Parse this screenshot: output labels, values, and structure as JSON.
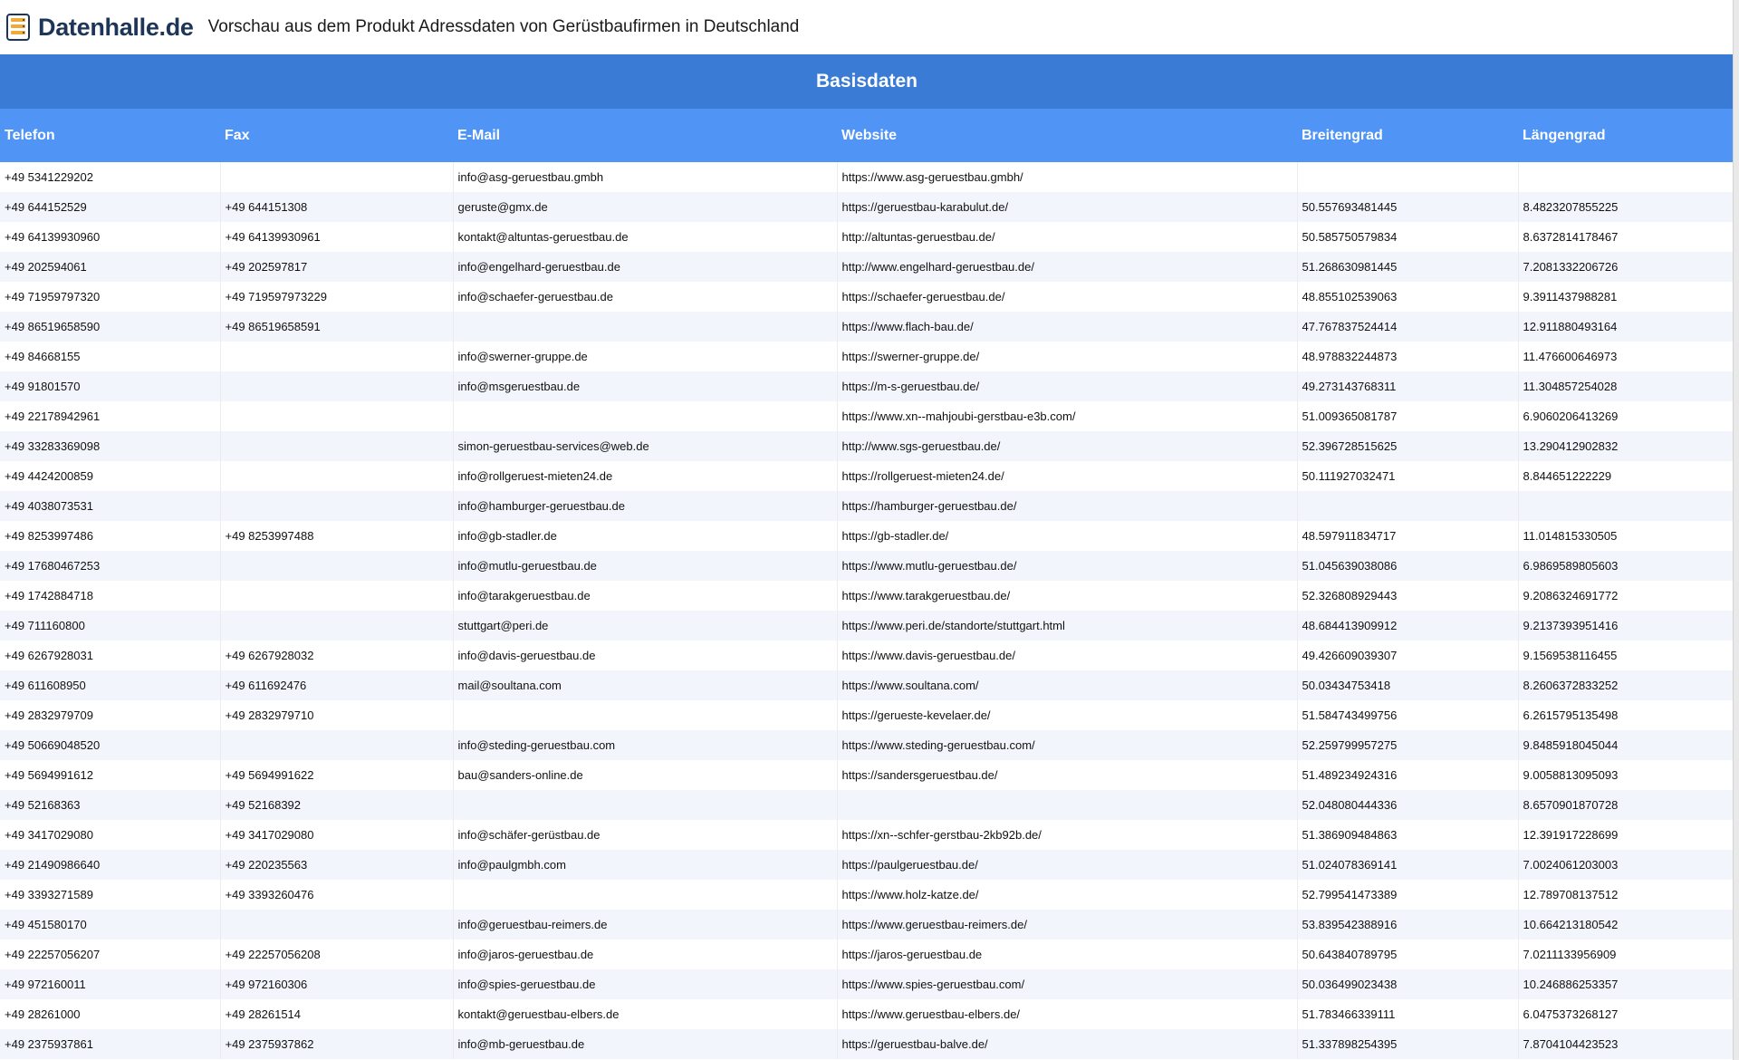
{
  "app": {
    "logo_text": "Datenhalle.de",
    "title": "Vorschau aus dem Produkt Adressdaten von Gerüstbaufirmen in Deutschland"
  },
  "section": {
    "title": "Basisdaten"
  },
  "table": {
    "columns": [
      "Telefon",
      "Fax",
      "E-Mail",
      "Website",
      "Breitengrad",
      "Längengrad"
    ],
    "rows": [
      [
        "+49 5341229202",
        "",
        "info@asg-geruestbau.gmbh",
        "https://www.asg-geruestbau.gmbh/",
        "",
        ""
      ],
      [
        "+49 644152529",
        "+49 644151308",
        "geruste@gmx.de",
        "https://geruestbau-karabulut.de/",
        "50.557693481445",
        "8.4823207855225"
      ],
      [
        "+49 64139930960",
        "+49 64139930961",
        "kontakt@altuntas-geruestbau.de",
        "http://altuntas-geruestbau.de/",
        "50.585750579834",
        "8.6372814178467"
      ],
      [
        "+49 202594061",
        "+49 202597817",
        "info@engelhard-geruestbau.de",
        "http://www.engelhard-geruestbau.de/",
        "51.268630981445",
        "7.2081332206726"
      ],
      [
        "+49 71959797320",
        "+49 719597973229",
        "info@schaefer-geruestbau.de",
        "https://schaefer-geruestbau.de/",
        "48.855102539063",
        "9.3911437988281"
      ],
      [
        "+49 86519658590",
        "+49 86519658591",
        "",
        "https://www.flach-bau.de/",
        "47.767837524414",
        "12.911880493164"
      ],
      [
        "+49 84668155",
        "",
        "info@swerner-gruppe.de",
        "https://swerner-gruppe.de/",
        "48.978832244873",
        "11.476600646973"
      ],
      [
        "+49 91801570",
        "",
        "info@msgeruestbau.de",
        "https://m-s-geruestbau.de/",
        "49.273143768311",
        "11.304857254028"
      ],
      [
        "+49 22178942961",
        "",
        "",
        "https://www.xn--mahjoubi-gerstbau-e3b.com/",
        "51.009365081787",
        "6.9060206413269"
      ],
      [
        "+49 33283369098",
        "",
        "simon-geruestbau-services@web.de",
        "http://www.sgs-geruestbau.de/",
        "52.396728515625",
        "13.290412902832"
      ],
      [
        "+49 4424200859",
        "",
        "info@rollgeruest-mieten24.de",
        "https://rollgeruest-mieten24.de/",
        "50.111927032471",
        "8.844651222229"
      ],
      [
        "+49 4038073531",
        "",
        "info@hamburger-geruestbau.de",
        "https://hamburger-geruestbau.de/",
        "",
        ""
      ],
      [
        "+49 8253997486",
        "+49 8253997488",
        "info@gb-stadler.de",
        "https://gb-stadler.de/",
        "48.597911834717",
        "11.014815330505"
      ],
      [
        "+49 17680467253",
        "",
        "info@mutlu-geruestbau.de",
        "https://www.mutlu-geruestbau.de/",
        "51.045639038086",
        "6.9869589805603"
      ],
      [
        "+49 1742884718",
        "",
        "info@tarakgeruestbau.de",
        "https://www.tarakgeruestbau.de/",
        "52.326808929443",
        "9.2086324691772"
      ],
      [
        "+49 711160800",
        "",
        "stuttgart@peri.de",
        "https://www.peri.de/standorte/stuttgart.html",
        "48.684413909912",
        "9.2137393951416"
      ],
      [
        "+49 6267928031",
        "+49 6267928032",
        "info@davis-geruestbau.de",
        "https://www.davis-geruestbau.de/",
        "49.426609039307",
        "9.1569538116455"
      ],
      [
        "+49 611608950",
        "+49 611692476",
        "mail@soultana.com",
        "https://www.soultana.com/",
        "50.03434753418",
        "8.2606372833252"
      ],
      [
        "+49 2832979709",
        "+49 2832979710",
        "",
        "https://gerueste-kevelaer.de/",
        "51.584743499756",
        "6.2615795135498"
      ],
      [
        "+49 50669048520",
        "",
        "info@steding-geruestbau.com",
        "https://www.steding-geruestbau.com/",
        "52.259799957275",
        "9.8485918045044"
      ],
      [
        "+49 5694991612",
        "+49 5694991622",
        "bau@sanders-online.de",
        "https://sandersgeruestbau.de/",
        "51.489234924316",
        "9.0058813095093"
      ],
      [
        "+49 52168363",
        "+49 52168392",
        "",
        "",
        "52.048080444336",
        "8.6570901870728"
      ],
      [
        "+49 3417029080",
        "+49 3417029080",
        "info@schäfer-gerüstbau.de",
        "https://xn--schfer-gerstbau-2kb92b.de/",
        "51.386909484863",
        "12.391917228699"
      ],
      [
        "+49 21490986640",
        "+49 220235563",
        "info@paulgmbh.com",
        "https://paulgeruestbau.de/",
        "51.024078369141",
        "7.0024061203003"
      ],
      [
        "+49 3393271589",
        "+49 3393260476",
        "",
        "https://www.holz-katze.de/",
        "52.799541473389",
        "12.789708137512"
      ],
      [
        "+49 451580170",
        "",
        "info@geruestbau-reimers.de",
        "https://www.geruestbau-reimers.de/",
        "53.839542388916",
        "10.664213180542"
      ],
      [
        "+49 22257056207",
        "+49 22257056208",
        "info@jaros-geruestbau.de",
        "https://jaros-geruestbau.de",
        "50.643840789795",
        "7.0211133956909"
      ],
      [
        "+49 972160011",
        "+49 972160306",
        "info@spies-geruestbau.de",
        "https://www.spies-geruestbau.com/",
        "50.036499023438",
        "10.246886253357"
      ],
      [
        "+49 28261000",
        "+49 28261514",
        "kontakt@geruestbau-elbers.de",
        "https://www.geruestbau-elbers.de/",
        "51.783466339111",
        "6.0475373268127"
      ],
      [
        "+49 2375937861",
        "+49 2375937862",
        "info@mb-geruestbau.de",
        "https://geruestbau-balve.de/",
        "51.337898254395",
        "7.8704104423523"
      ]
    ]
  }
}
